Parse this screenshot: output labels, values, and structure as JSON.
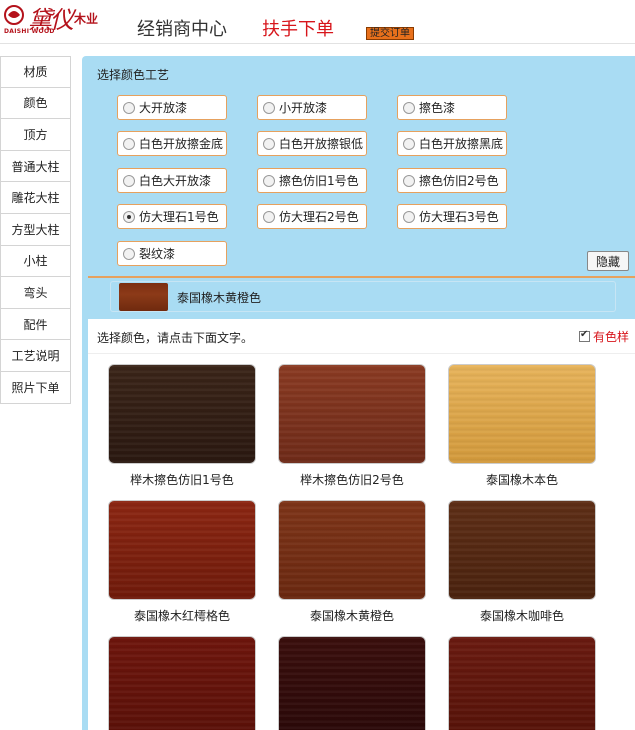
{
  "header": {
    "brand_cn": "黛仪",
    "brand_suffix": "木业",
    "brand_en": "DAISHI WOOD",
    "nav_dealer": "经销商中心",
    "nav_order": "扶手下单",
    "submit_button": "提交订单"
  },
  "sidebar": {
    "items": [
      "材质",
      "颜色",
      "顶方",
      "普通大柱",
      "雕花大柱",
      "方型大柱",
      "小柱",
      "弯头",
      "配件",
      "工艺说明",
      "照片下单"
    ]
  },
  "craft": {
    "title": "选择颜色工艺",
    "options": [
      {
        "label": "大开放漆",
        "checked": false
      },
      {
        "label": "小开放漆",
        "checked": false
      },
      {
        "label": "擦色漆",
        "checked": false
      },
      {
        "label": "白色开放擦金底",
        "checked": false
      },
      {
        "label": "白色开放擦银低",
        "checked": false
      },
      {
        "label": "白色开放擦黑底",
        "checked": false
      },
      {
        "label": "白色大开放漆",
        "checked": false
      },
      {
        "label": "擦色仿旧1号色",
        "checked": false
      },
      {
        "label": "擦色仿旧2号色",
        "checked": false
      },
      {
        "label": "仿大理石1号色",
        "checked": true
      },
      {
        "label": "仿大理石2号色",
        "checked": false
      },
      {
        "label": "仿大理石3号色",
        "checked": false
      },
      {
        "label": "裂纹漆",
        "checked": false
      }
    ],
    "hide_button": "隐藏"
  },
  "selected": {
    "label": "泰国橡木黄橙色"
  },
  "colors": {
    "hint": "选择颜色，请点击下面文字。",
    "sample_label": "有色样",
    "sample_checked": true,
    "swatches": [
      {
        "label": "榉木擦色仿旧1号色",
        "color_top": "#3a2418",
        "color_bottom": "#2a1810"
      },
      {
        "label": "榉木擦色仿旧2号色",
        "color_top": "#8a3a22",
        "color_bottom": "#6e2a18"
      },
      {
        "label": "泰国橡木本色",
        "color_top": "#e7b35a",
        "color_bottom": "#d39a3c"
      },
      {
        "label": "泰国橡木红樗格色",
        "color_top": "#8c2612",
        "color_bottom": "#6f1a0a"
      },
      {
        "label": "泰国橡木黄橙色",
        "color_top": "#7e3418",
        "color_bottom": "#6a2810"
      },
      {
        "label": "泰国橡木咖啡色",
        "color_top": "#5e2e16",
        "color_bottom": "#4a220e"
      },
      {
        "label": "",
        "color_top": "#6e150c",
        "color_bottom": "#5a1008"
      },
      {
        "label": "",
        "color_top": "#3a0e0c",
        "color_bottom": "#2a0808"
      },
      {
        "label": "",
        "color_top": "#6a1a10",
        "color_bottom": "#561208"
      }
    ]
  }
}
